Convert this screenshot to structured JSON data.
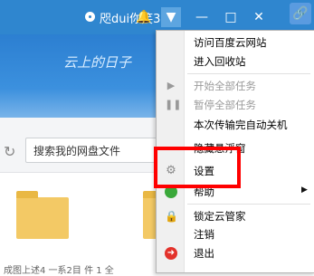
{
  "titlebar": {
    "username": "咫dui你笑3",
    "icons": [
      "bell-icon",
      "menu-caret-icon",
      "minimize-icon",
      "maximize-icon",
      "close-icon",
      "share-icon"
    ]
  },
  "banner": {
    "text": "云上的日子"
  },
  "search": {
    "placeholder": "搜索我的网盘文件"
  },
  "files": {
    "info": "成图上述4 一系2目          件 1 全"
  },
  "menu": {
    "items": [
      {
        "label": "访问百度云网站",
        "enabled": true
      },
      {
        "label": "进入回收站",
        "enabled": true
      },
      {
        "label": "开始全部任务",
        "enabled": false,
        "icon": "play-icon"
      },
      {
        "label": "暂停全部任务",
        "enabled": false,
        "icon": "pause-icon"
      },
      {
        "label": "本次传输完自动关机",
        "enabled": true
      },
      {
        "label": "隐藏悬浮窗",
        "enabled": true
      },
      {
        "label": "设置",
        "enabled": true,
        "icon": "gear-icon"
      },
      {
        "label": "帮助",
        "enabled": true,
        "icon": "help-icon",
        "submenu": true
      },
      {
        "label": "锁定云管家",
        "enabled": true,
        "icon": "lock-icon"
      },
      {
        "label": "注销",
        "enabled": true
      },
      {
        "label": "退出",
        "enabled": true,
        "icon": "exit-icon"
      }
    ]
  },
  "annotation": {
    "highlighted_item": "设置",
    "color": "#ff0000"
  },
  "colors": {
    "titlebar": "#2f86cf",
    "folder": "#f3c965"
  }
}
